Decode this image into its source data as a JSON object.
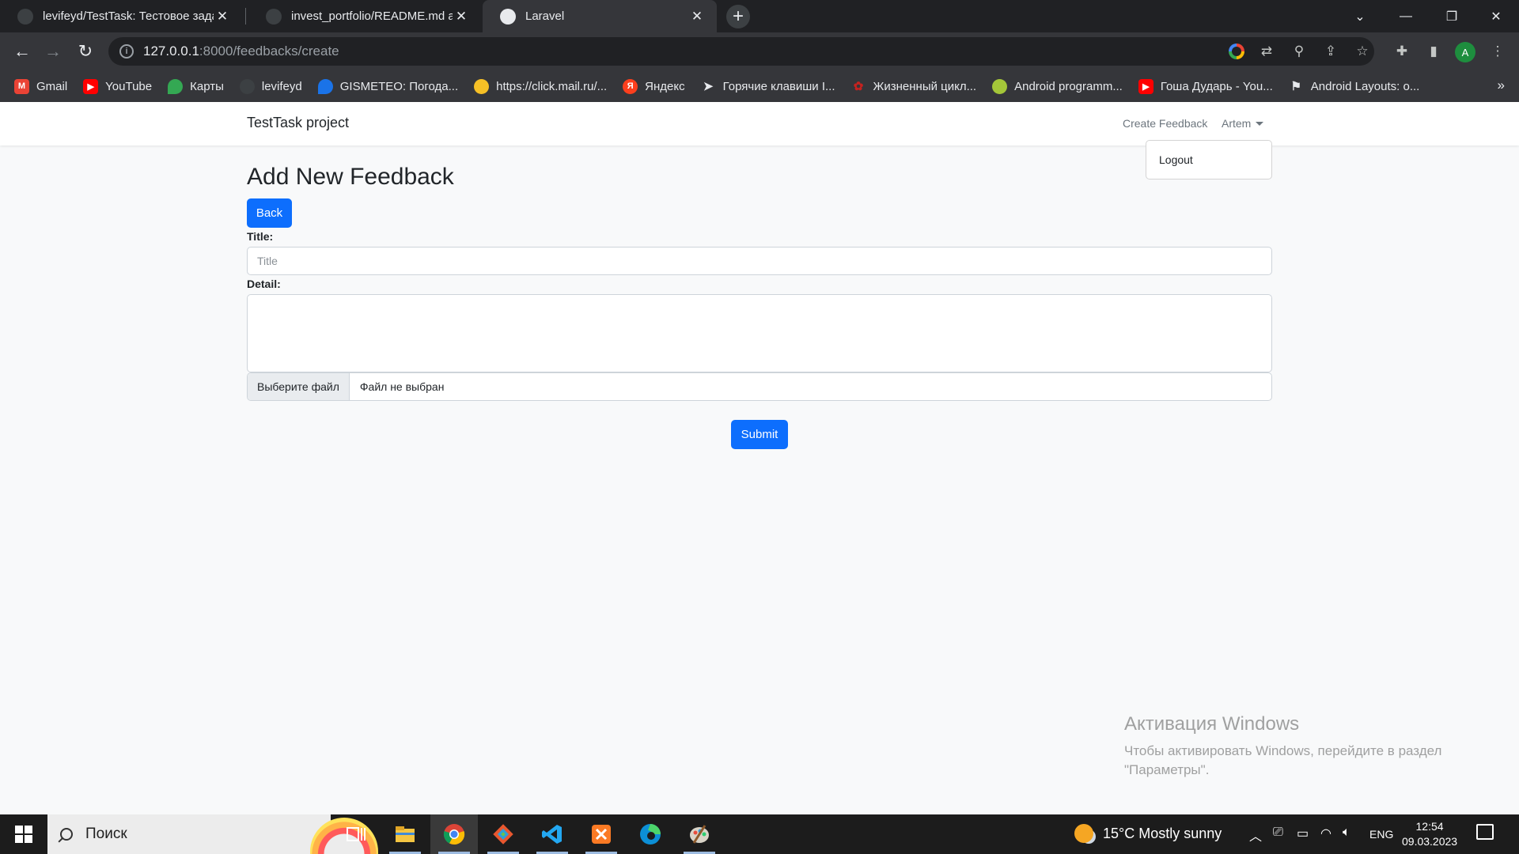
{
  "browser": {
    "tabs": [
      {
        "title": "levifeyd/TestTask: Тестовое задание",
        "icon": "github-icon"
      },
      {
        "title": "invest_portfolio/README.md at main",
        "icon": "github-icon"
      },
      {
        "title": "Laravel",
        "icon": "globe-icon"
      }
    ],
    "url_host": "127.0.0.1",
    "url_path": ":8000/feedbacks/create",
    "profile_initial": "A",
    "bookmarks": [
      {
        "label": "Gmail",
        "icon": "gmail-icon",
        "color": "#ea4335"
      },
      {
        "label": "YouTube",
        "icon": "youtube-icon",
        "color": "#ff0000"
      },
      {
        "label": "Карты",
        "icon": "maps-icon",
        "color": "#34a853"
      },
      {
        "label": "levifeyd",
        "icon": "github-icon",
        "color": "#3c4043"
      },
      {
        "label": "GISMETEO: Погода...",
        "icon": "gismeteo-icon",
        "color": "#1a73e8"
      },
      {
        "label": "https://click.mail.ru/...",
        "icon": "lightbulb-icon",
        "color": "#f6c026"
      },
      {
        "label": "Яндекс",
        "icon": "yandex-icon",
        "color": "#fc3f1d"
      },
      {
        "label": "Горячие клавиши I...",
        "icon": "arrow-icon",
        "color": "#5f6368"
      },
      {
        "label": "Жизненный цикл...",
        "icon": "paw-icon",
        "color": "#c5221f"
      },
      {
        "label": "Android programm...",
        "icon": "android-icon",
        "color": "#a4c639"
      },
      {
        "label": "Гоша Дударь - You...",
        "icon": "youtube-icon",
        "color": "#ff0000"
      },
      {
        "label": "Android Layouts: o...",
        "icon": "bookmark-icon",
        "color": "#5f6368"
      }
    ]
  },
  "app": {
    "brand": "TestTask project",
    "nav_create": "Create Feedback",
    "nav_user": "Artem",
    "dropdown_logout": "Logout",
    "page_title": "Add New Feedback",
    "back_label": "Back",
    "title_label": "Title:",
    "title_placeholder": "Title",
    "detail_label": "Detail:",
    "file_button": "Выберите файл",
    "file_status": "Файл не выбран",
    "submit_label": "Submit",
    "accent_color": "#0d6efd"
  },
  "watermark": {
    "line1": "Активация Windows",
    "line2": "Чтобы активировать Windows, перейдите в раздел",
    "line3": "\"Параметры\"."
  },
  "taskbar": {
    "search_text": "Поиск",
    "weather": "15°C  Mostly sunny",
    "language": "ENG",
    "time": "12:54",
    "date": "09.03.2023"
  }
}
